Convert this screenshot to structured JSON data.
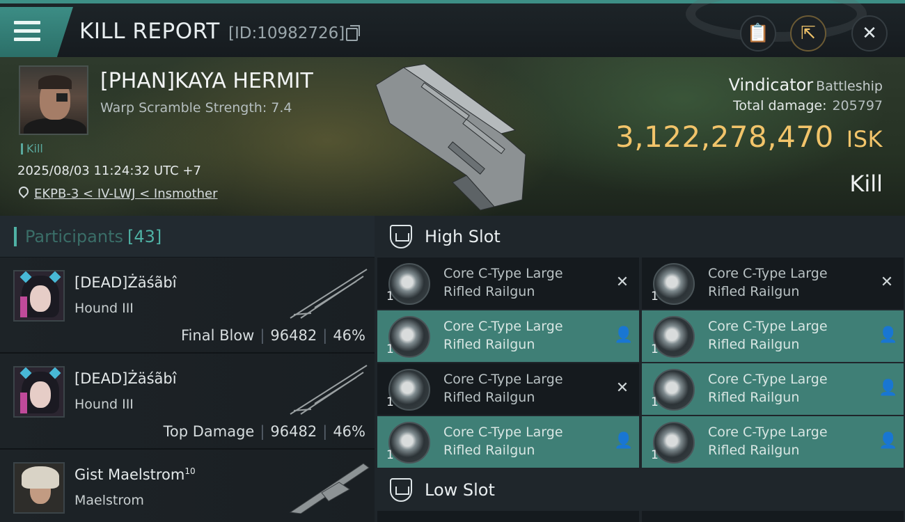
{
  "header": {
    "title": "KILL REPORT",
    "id_text": "[ID:10982726]"
  },
  "victim": {
    "name": "[PHAN]KAYA HERMIT",
    "warp_scramble": "Warp Scramble Strength: 7.4",
    "tag": "Kill",
    "datetime": "2025/08/03 11:24:32 UTC +7",
    "location": "EKPB-3 < IV-LWJ < Insmother",
    "ship": "Vindicator",
    "ship_class": "Battleship",
    "total_damage_label": "Total damage:",
    "total_damage": "205797",
    "isk_value": "3,122,278,470",
    "isk_unit": "ISK",
    "result": "Kill"
  },
  "participants": {
    "label": "Participants",
    "count": "[43]",
    "rows": [
      {
        "name": "[DEAD]Żäśãbî",
        "ship": "Hound III",
        "role": "Final Blow",
        "damage": "96482",
        "percent": "46%"
      },
      {
        "name": "[DEAD]Żäśãbî",
        "ship": "Hound III",
        "role": "Top Damage",
        "damage": "96482",
        "percent": "46%"
      },
      {
        "name": "Gist Maelstrom",
        "name_sup": "10",
        "ship": "Maelstrom"
      }
    ]
  },
  "high_slot": {
    "label": "High Slot",
    "modules": [
      {
        "qty": "1",
        "line1": "Core C-Type Large",
        "line2": "Rifled Railgun",
        "state": "destroyed"
      },
      {
        "qty": "1",
        "line1": "Core C-Type Large",
        "line2": "Rifled Railgun",
        "state": "destroyed"
      },
      {
        "qty": "1",
        "line1": "Core C-Type Large",
        "line2": "Rifled Railgun",
        "state": "dropped"
      },
      {
        "qty": "1",
        "line1": "Core C-Type Large",
        "line2": "Rifled Railgun",
        "state": "dropped"
      },
      {
        "qty": "1",
        "line1": "Core C-Type Large",
        "line2": "Rifled Railgun",
        "state": "destroyed"
      },
      {
        "qty": "1",
        "line1": "Core C-Type Large",
        "line2": "Rifled Railgun",
        "state": "dropped"
      },
      {
        "qty": "1",
        "line1": "Core C-Type Large",
        "line2": "Rifled Railgun",
        "state": "dropped"
      },
      {
        "qty": "1",
        "line1": "Core C-Type Large",
        "line2": "Rifled Railgun",
        "state": "dropped"
      }
    ]
  },
  "low_slot": {
    "label": "Low Slot"
  },
  "colors": {
    "accent": "#4fb1a4",
    "isk": "#f2c46a",
    "dropped_bg": "#3f7f76"
  }
}
